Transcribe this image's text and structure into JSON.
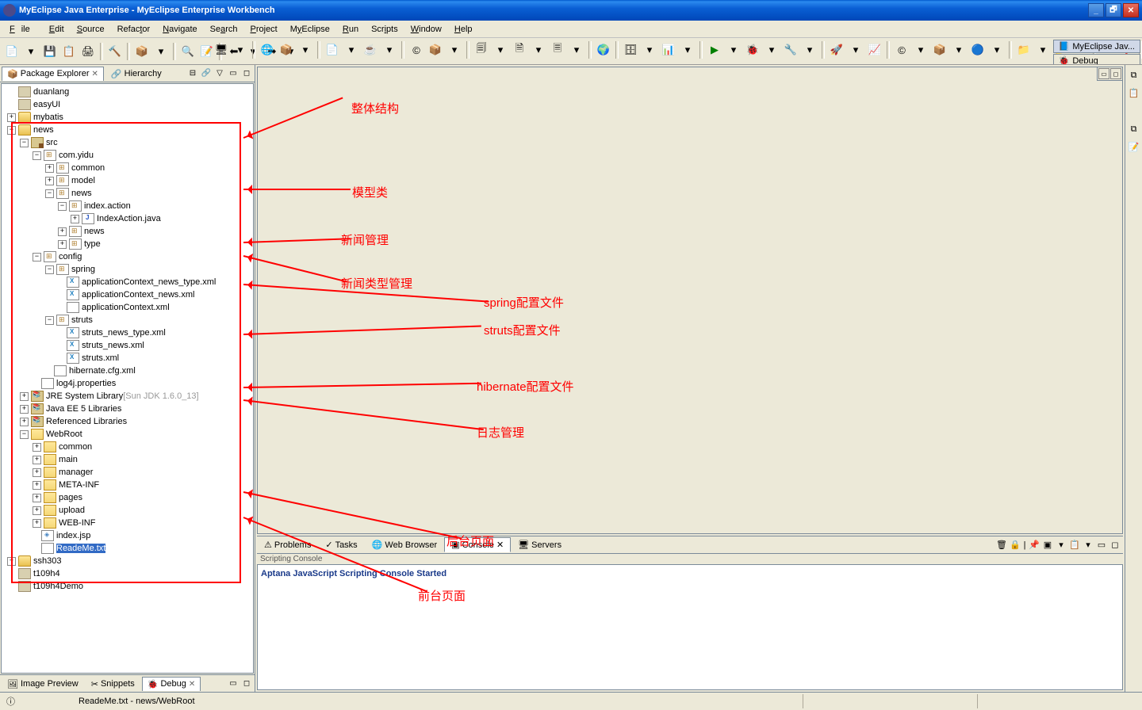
{
  "window": {
    "title": "MyEclipse Java Enterprise - MyEclipse Enterprise Workbench"
  },
  "menu": [
    "File",
    "Edit",
    "Source",
    "Refactor",
    "Navigate",
    "Search",
    "Project",
    "MyEclipse",
    "Run",
    "Scripts",
    "Window",
    "Help"
  ],
  "perspectives": {
    "p1": "MyEclipse Jav...",
    "p2": "Debug"
  },
  "views": {
    "package_explorer": "Package Explorer",
    "hierarchy": "Hierarchy",
    "image_preview": "Image Preview",
    "snippets": "Snippets",
    "debug": "Debug"
  },
  "bottom_tabs": {
    "problems": "Problems",
    "tasks": "Tasks",
    "web_browser": "Web Browser",
    "console": "Console",
    "servers": "Servers"
  },
  "console": {
    "header": "Scripting Console",
    "text": "Aptana JavaScript Scripting Console Started"
  },
  "tree": {
    "duanlang": "duanlang",
    "easyUI": "easyUI",
    "mybatis": "mybatis",
    "news": "news",
    "src": "src",
    "com_yidu": "com.yidu",
    "common": "common",
    "model": "model",
    "news_pkg": "news",
    "index_action": "index.action",
    "IndexAction": "IndexAction.java",
    "news_sub": "news",
    "type": "type",
    "config": "config",
    "spring": "spring",
    "appctx_news_type": "applicationContext_news_type.xml",
    "appctx_news": "applicationContext_news.xml",
    "appctx": "applicationContext.xml",
    "struts": "struts",
    "struts_news_type": "struts_news_type.xml",
    "struts_news": "struts_news.xml",
    "struts_xml": "struts.xml",
    "hibernate_cfg": "hibernate.cfg.xml",
    "log4j": "log4j.properties",
    "jre_lib": "JRE System Library",
    "jre_tag": " [Sun JDK 1.6.0_13]",
    "javaee_lib": "Java EE 5 Libraries",
    "ref_lib": "Referenced Libraries",
    "webroot": "WebRoot",
    "wr_common": "common",
    "wr_main": "main",
    "wr_manager": "manager",
    "wr_metainf": "META-INF",
    "wr_pages": "pages",
    "wr_upload": "upload",
    "wr_webinf": "WEB-INF",
    "wr_indexjsp": "index.jsp",
    "wr_readme": "ReadeMe.txt",
    "ssh303": "ssh303",
    "t109h4": "t109h4",
    "t109h4Demo": "t109h4Demo"
  },
  "annotations": {
    "a1": "整体结构",
    "a2": "模型类",
    "a3": "新闻管理",
    "a4": "新闻类型管理",
    "a5": "spring配置文件",
    "a6": "struts配置文件",
    "a7": "hibernate配置文件",
    "a8": "日志管理",
    "a9": "后台页面",
    "a10": "前台页面"
  },
  "status": {
    "path": "ReadeMe.txt - news/WebRoot"
  }
}
